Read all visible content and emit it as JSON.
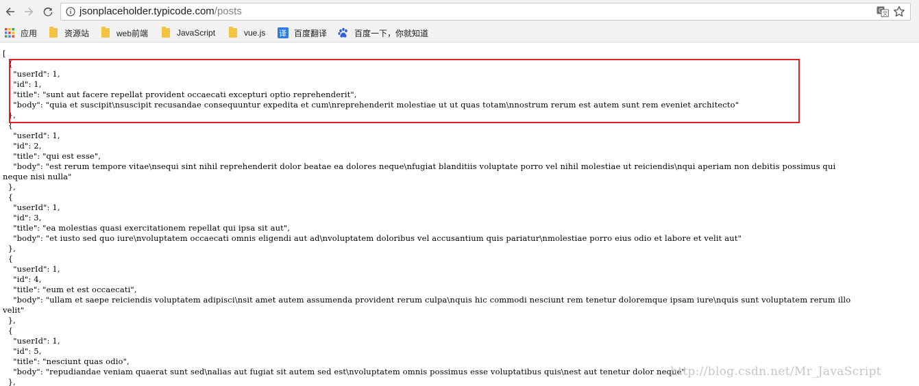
{
  "browser": {
    "url_host": "jsonplaceholder.typicode.com",
    "url_path": "/posts",
    "translate_icon": "translate-icon",
    "star_icon": "bookmark-star-icon"
  },
  "bookmarks": [
    {
      "label": "应用",
      "icon": "apps-grid-icon"
    },
    {
      "label": "资源站",
      "icon": "folder-icon"
    },
    {
      "label": "web前端",
      "icon": "folder-icon"
    },
    {
      "label": "JavaScript",
      "icon": "folder-icon"
    },
    {
      "label": "vue.js",
      "icon": "folder-icon"
    },
    {
      "label": "百度翻译",
      "icon": "baidu-translate-icon"
    },
    {
      "label": "百度一下，你就知道",
      "icon": "baidu-paw-icon"
    }
  ],
  "content": {
    "lines": [
      "[",
      "  {",
      "    \"userId\": 1,",
      "    \"id\": 1,",
      "    \"title\": \"sunt aut facere repellat provident occaecati excepturi optio reprehenderit\",",
      "    \"body\": \"quia et suscipit\\nsuscipit recusandae consequuntur expedita et cum\\nreprehenderit molestiae ut ut quas totam\\nnostrum rerum est autem sunt rem eveniet architecto\"",
      "  },",
      "  {",
      "    \"userId\": 1,",
      "    \"id\": 2,",
      "    \"title\": \"qui est esse\",",
      "    \"body\": \"est rerum tempore vitae\\nsequi sint nihil reprehenderit dolor beatae ea dolores neque\\nfugiat blanditiis voluptate porro vel nihil molestiae ut reiciendis\\nqui aperiam non debitis possimus qui",
      "neque nisi nulla\"",
      "  },",
      "  {",
      "    \"userId\": 1,",
      "    \"id\": 3,",
      "    \"title\": \"ea molestias quasi exercitationem repellat qui ipsa sit aut\",",
      "    \"body\": \"et iusto sed quo iure\\nvoluptatem occaecati omnis eligendi aut ad\\nvoluptatem doloribus vel accusantium quis pariatur\\nmolestiae porro eius odio et labore et velit aut\"",
      "  },",
      "  {",
      "    \"userId\": 1,",
      "    \"id\": 4,",
      "    \"title\": \"eum et est occaecati\",",
      "    \"body\": \"ullam et saepe reiciendis voluptatem adipisci\\nsit amet autem assumenda provident rerum culpa\\nquis hic commodi nesciunt rem tenetur doloremque ipsam iure\\nquis sunt voluptatem rerum illo",
      "velit\"",
      "  },",
      "  {",
      "    \"userId\": 1,",
      "    \"id\": 5,",
      "    \"title\": \"nesciunt quas odio\",",
      "    \"body\": \"repudiandae veniam quaerat sunt sed\\nalias aut fugiat sit autem sed est\\nvoluptatem omnis possimus esse voluptatibus quis\\nest aut tenetur dolor neque\"",
      "  },"
    ],
    "watermark": "http://blog.csdn.net/Mr_JavaScript",
    "highlight_color": "#e02020"
  }
}
